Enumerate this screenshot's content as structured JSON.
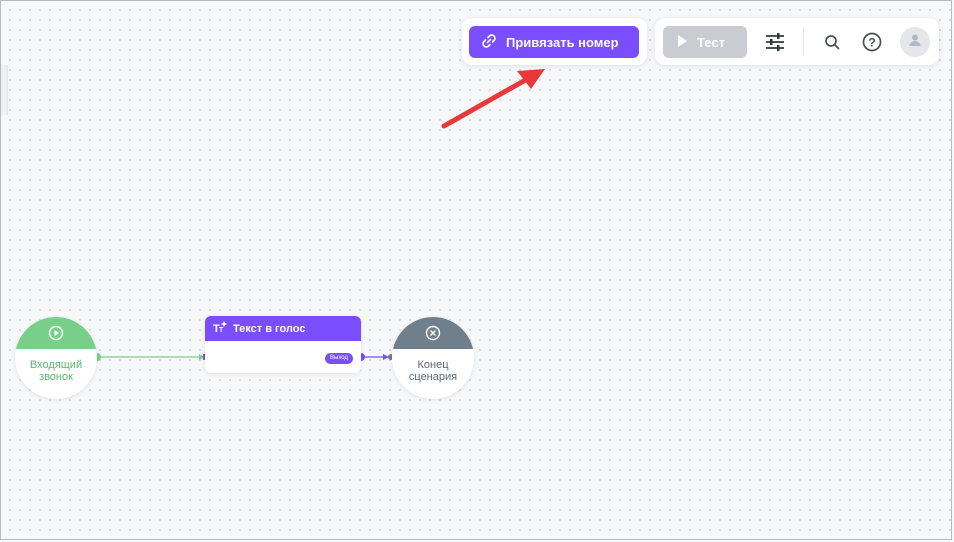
{
  "toolbar": {
    "bind_number_label": "Привязать номер",
    "test_label": "Тест",
    "icons": [
      "link-icon",
      "play-icon",
      "sliders-icon",
      "search-icon",
      "help-icon",
      "user-icon"
    ]
  },
  "nodes": {
    "start": {
      "label_line1": "Входящий",
      "label_line2": "звонок"
    },
    "tts": {
      "title": "Текст в голос",
      "output_label": "Выход"
    },
    "end": {
      "label_line1": "Конец",
      "label_line2": "сценария"
    }
  },
  "colors": {
    "accent": "#7a4dff",
    "start": "#78cf8a",
    "end": "#6f7f8c",
    "disabled": "#c9ccd1",
    "annotation_arrow": "#e8393a"
  }
}
